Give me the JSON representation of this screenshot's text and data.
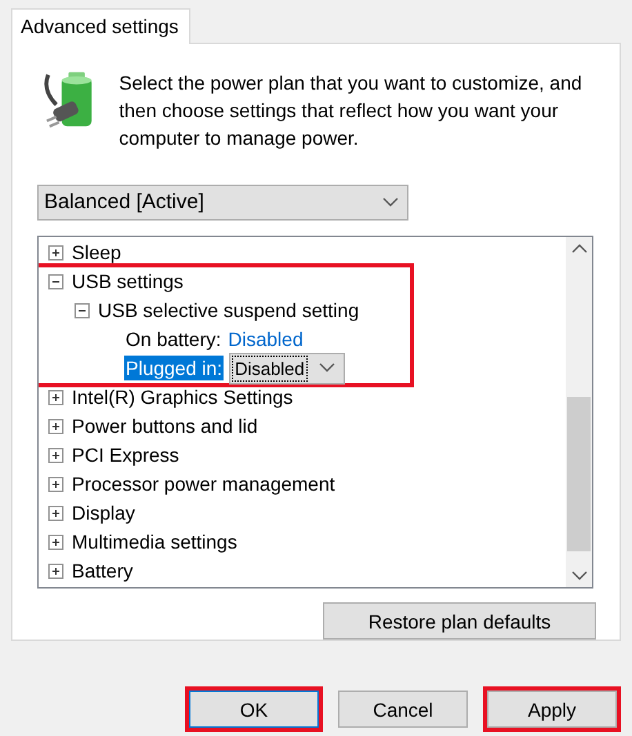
{
  "tabs": [
    {
      "label": "Advanced settings",
      "selected": true
    }
  ],
  "description": "Select the power plan that you want to customize, and then choose settings that reflect how you want your computer to manage power.",
  "plan_dropdown": {
    "value": "Balanced [Active]"
  },
  "tree": [
    {
      "label": "Sleep",
      "expanded": false,
      "highlighted": false
    },
    {
      "label": "USB settings",
      "expanded": true,
      "highlighted": true,
      "children": [
        {
          "label": "USB selective suspend setting",
          "expanded": true,
          "highlighted": false,
          "settings": [
            {
              "kind": "value",
              "label": "On battery:",
              "value": "Disabled",
              "selected": false
            },
            {
              "kind": "dropdown",
              "label": "Plugged in:",
              "value": "Disabled",
              "selected": true
            }
          ]
        }
      ]
    },
    {
      "label": "Intel(R) Graphics Settings",
      "expanded": false,
      "highlighted": false
    },
    {
      "label": "Power buttons and lid",
      "expanded": false,
      "highlighted": false
    },
    {
      "label": "PCI Express",
      "expanded": false,
      "highlighted": false
    },
    {
      "label": "Processor power management",
      "expanded": false,
      "highlighted": false
    },
    {
      "label": "Display",
      "expanded": false,
      "highlighted": false
    },
    {
      "label": "Multimedia settings",
      "expanded": false,
      "highlighted": false
    },
    {
      "label": "Battery",
      "expanded": false,
      "highlighted": false
    }
  ],
  "restore_button": "Restore plan defaults",
  "buttons": [
    {
      "label": "OK",
      "highlighted": true,
      "focused": true
    },
    {
      "label": "Cancel",
      "highlighted": false,
      "focused": false
    },
    {
      "label": "Apply",
      "highlighted": true,
      "focused": false
    }
  ]
}
